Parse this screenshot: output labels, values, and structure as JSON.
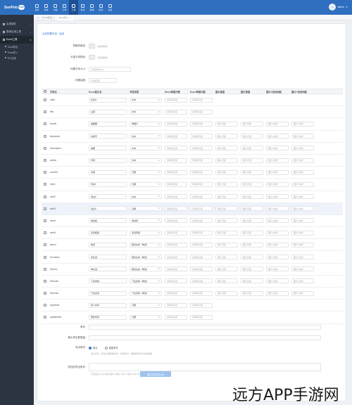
{
  "app": {
    "logo_text": "SunPub",
    "logo_badge": "CMS"
  },
  "topnav": [
    {
      "label": "首页"
    },
    {
      "label": "系统"
    },
    {
      "label": "内容"
    },
    {
      "label": "订单"
    },
    {
      "label": "工具",
      "active": true
    },
    {
      "label": "发布"
    },
    {
      "label": "数据"
    },
    {
      "label": "报表"
    },
    {
      "label": "设置"
    }
  ],
  "user": {
    "avatar": "admin",
    "name": "admin"
  },
  "sidebar": {
    "items": [
      {
        "label": "应用插件"
      },
      {
        "label": "表单应用工具"
      },
      {
        "label": "Excel工具",
        "active": true
      }
    ],
    "subs": [
      {
        "label": "Excel导出"
      },
      {
        "label": "Excel导入"
      },
      {
        "label": "DIY应用"
      }
    ]
  },
  "tabs": [
    {
      "label": "Excel导出"
    },
    {
      "label": "Excel导入",
      "active": true
    }
  ],
  "breadcrumb": "当前配置内容 · 返回",
  "form": {
    "header_bg": {
      "label": "表格背景色:",
      "hint": "请选择颜色"
    },
    "header_fg": {
      "label": "头部字体颜色:",
      "hint": "请选择颜色"
    },
    "header_font": {
      "label": "标题字体大小:",
      "placeholder": "标题字体大小"
    },
    "row_height": {
      "label": "标题高度:",
      "placeholder": "标题高度"
    }
  },
  "table": {
    "headers": {
      "field": "字段名",
      "title": "Excel显示名",
      "type": "字段类型",
      "width": "Excel单格列宽",
      "height": "Excel单格列高",
      "pic_h": "图片高度",
      "pic_w": "图片宽度",
      "x": "图片X坐标间距",
      "y": "图片Y坐标间距"
    },
    "placeholders": {
      "width": "请填写宽度",
      "height": "请填写高度",
      "pic": "图片高度",
      "x": "图片X坐标",
      "y": "图片Y坐标"
    },
    "rows": [
      {
        "field": "catid",
        "title": "栏目id",
        "type": "文本",
        "pic": false
      },
      {
        "field": "title",
        "title": "主题",
        "type": "文本",
        "pic": false
      },
      {
        "field": "thumb",
        "title": "缩略图",
        "type": "单图片",
        "pic": true
      },
      {
        "field": "keywords",
        "title": "关键字",
        "type": "文本",
        "pic": true
      },
      {
        "field": "description",
        "title": "摘要",
        "type": "文本",
        "pic": true
      },
      {
        "field": "author",
        "title": "作者",
        "type": "文本",
        "pic": true
      },
      {
        "field": "content",
        "title": "内容",
        "type": "日期",
        "pic": true
      },
      {
        "field": "sect1",
        "title": "测试1",
        "type": "日期",
        "pic": true
      },
      {
        "field": "sect2",
        "title": "测试2",
        "type": "文本",
        "pic": true
      },
      {
        "field": "sect3",
        "title": "测试3",
        "type": "日期",
        "pic": true,
        "highlight": true
      },
      {
        "field": "sectd",
        "title": "单选框",
        "type": "单选项",
        "pic": true
      },
      {
        "field": "sect5",
        "title": "多选框组",
        "type": "多选项组",
        "pic": true
      },
      {
        "field": "lianxu",
        "title": "链接",
        "type": "随机生成（单选）",
        "pic": true
      },
      {
        "field": "Sundemo",
        "title": "多栏选",
        "type": "随机生成（单选）",
        "pic": true
      },
      {
        "field": "Sdemo",
        "title": "单栏选",
        "type": "随机生成（单选）",
        "pic": true
      },
      {
        "field": "Stemum",
        "title": "下拉单选",
        "type": "下拉选项（单选）",
        "pic": true
      },
      {
        "field": "Stemum",
        "title": "下拉多选",
        "type": "下拉选项（单选）",
        "pic": true
      },
      {
        "field": "inputtime",
        "title": "录入时间",
        "type": "日期",
        "pic": false
      },
      {
        "field": "updatetime",
        "title": "更新时间",
        "type": "日期",
        "pic": false
      }
    ]
  },
  "bottom": {
    "where": {
      "label": "条件:"
    },
    "max_rows": {
      "label": "最大导出数据量:"
    },
    "export_cond": {
      "label": "导出条件:",
      "options": [
        "默认",
        "搜索条件"
      ],
      "hint": "默认导出：导出全部数据条件，搜索导出：根据搜索条件导出数据"
    },
    "extra": {
      "label": "附加的导出条件:",
      "hint": "可直接写入SQL条件语句, 例如: Catid>'某值' AND 状态='正常'"
    }
  },
  "submit_label": "保存并导出Excel",
  "watermark": "远方APP手游网"
}
